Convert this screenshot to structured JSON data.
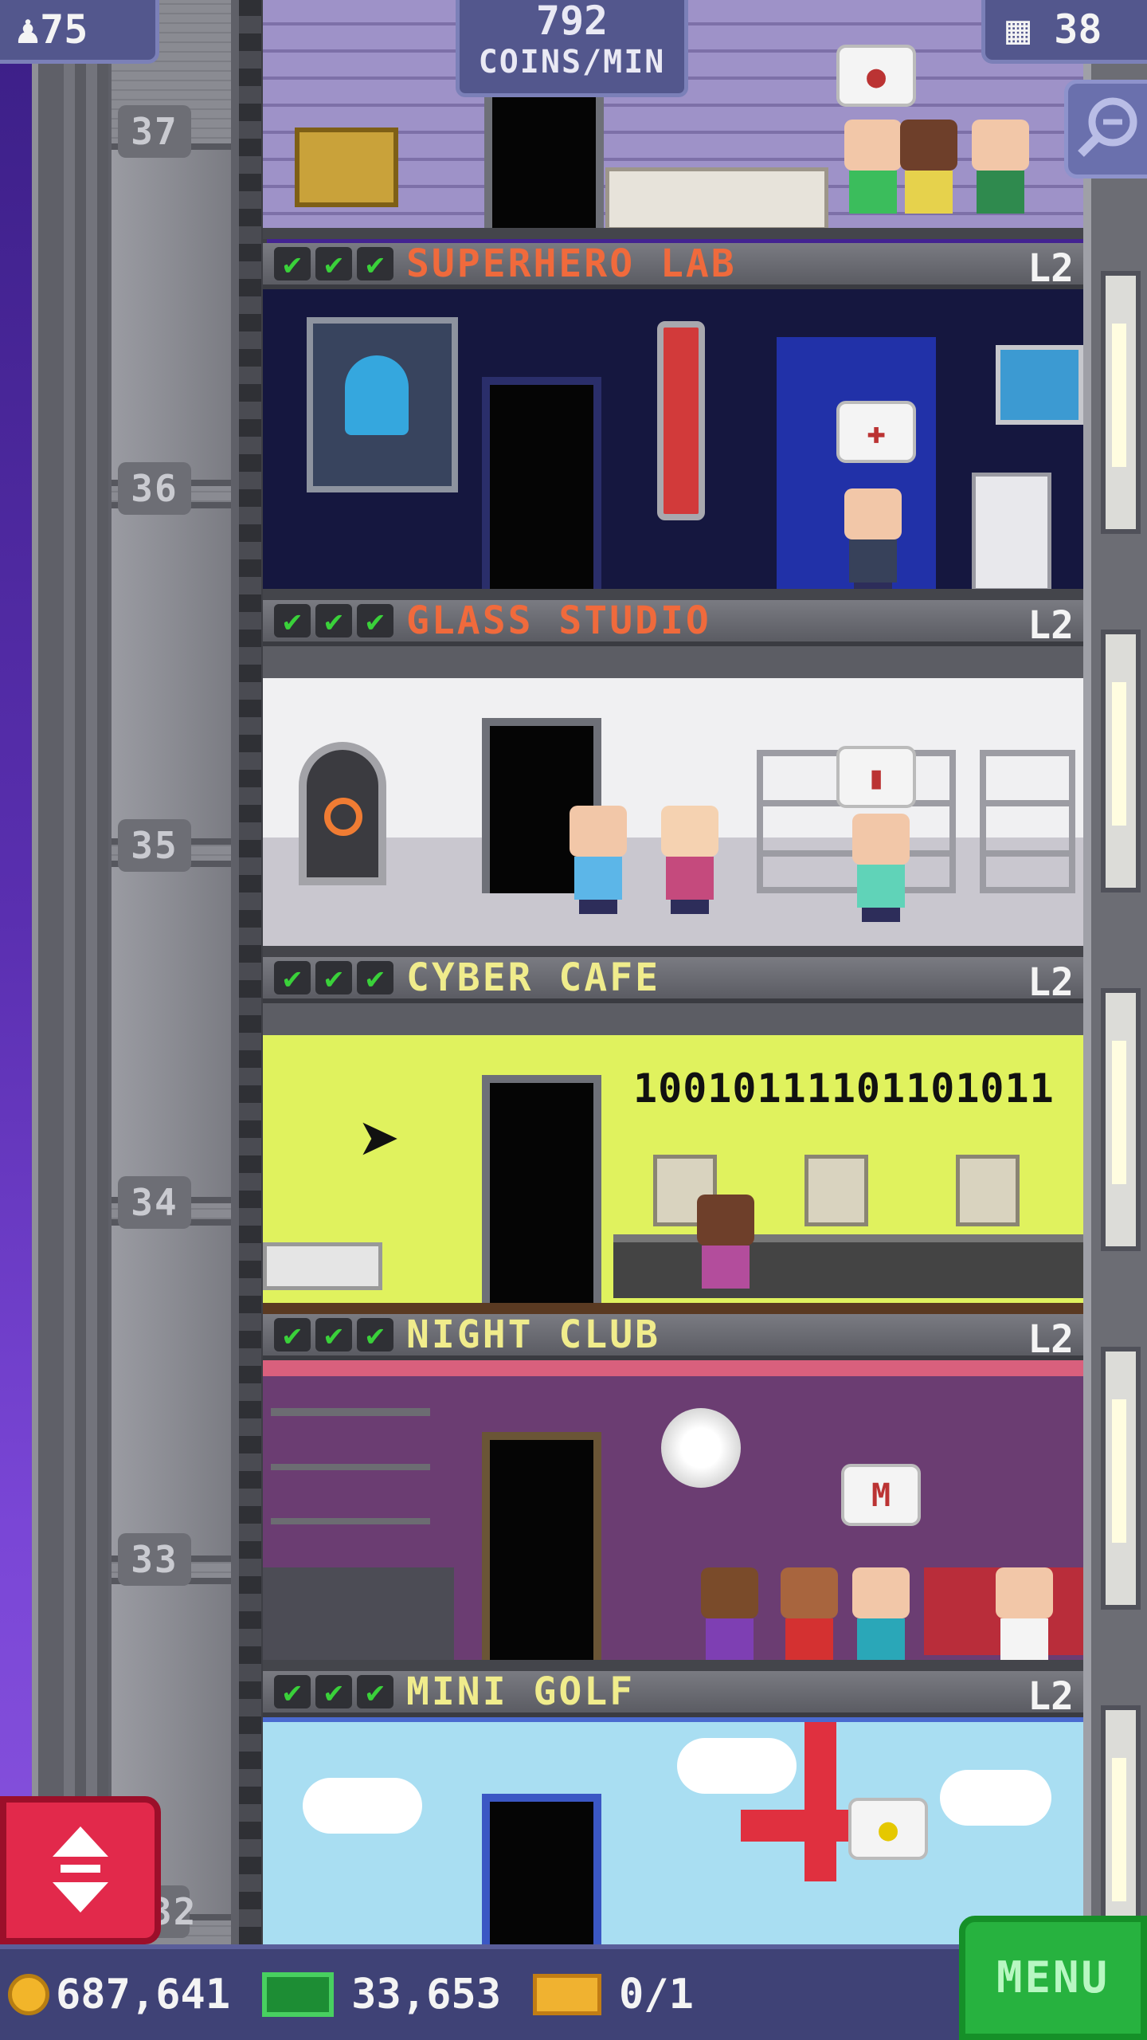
{
  "hud": {
    "population": "75",
    "coins_rate_value": "792",
    "coins_rate_unit": "COINS/MIN",
    "floor_count": "38"
  },
  "shaft_floors": [
    "37",
    "36",
    "35",
    "34",
    "33",
    "32"
  ],
  "floors": [
    {
      "name": "SUPERHERO LAB",
      "level": "L2",
      "name_color": "#f06a3c",
      "bg": "#15173f"
    },
    {
      "name": "GLASS STUDIO",
      "level": "L2",
      "name_color": "#f06a3c",
      "bg": "#d9d9dd"
    },
    {
      "name": "CYBER CAFE",
      "level": "L2",
      "name_color": "#f0ec8c",
      "bg": "#e0f25e",
      "binary_text": "10010111101101011"
    },
    {
      "name": "NIGHT CLUB",
      "level": "L2",
      "name_color": "#f0ec8c",
      "bg": "#6b3d72"
    },
    {
      "name": "MINI GOLF",
      "level": "L2",
      "name_color": "#f0ec8c",
      "bg": "#a9def2"
    }
  ],
  "bottom_bar": {
    "coins": "687,641",
    "bux": "33,653",
    "tickets": "0/1",
    "menu_label": "MENU"
  },
  "icons": {
    "check": "✔",
    "updown": "⬍"
  }
}
